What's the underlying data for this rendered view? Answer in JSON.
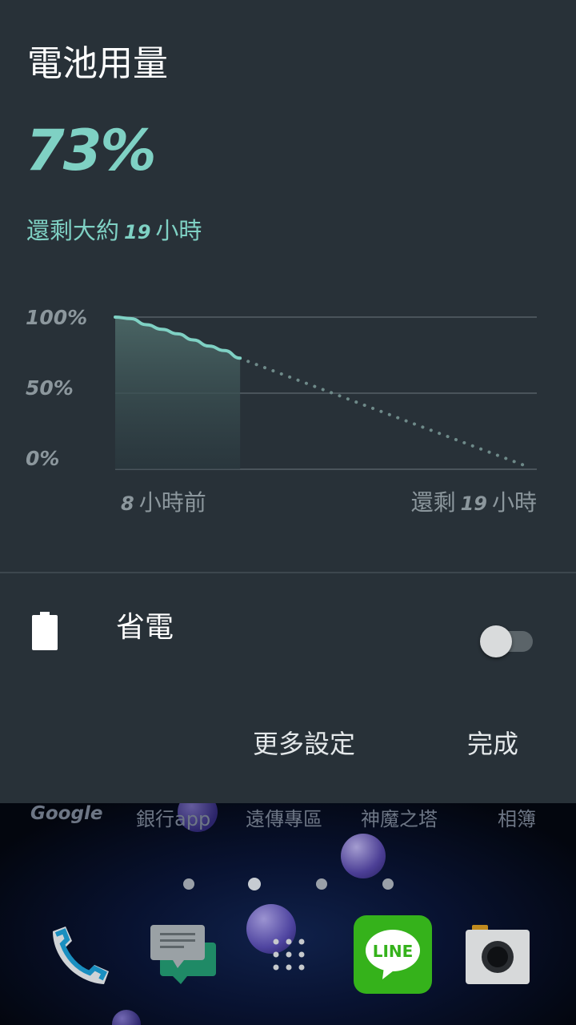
{
  "panel": {
    "title": "電池用量",
    "percent": "73%",
    "remaining_prefix": "還剩大約",
    "remaining_hours": "19",
    "remaining_unit": "小時"
  },
  "chart_data": {
    "type": "area",
    "title": "",
    "xlabel": "",
    "ylabel": "",
    "y_tick_labels": [
      "100%",
      "50%",
      "0%"
    ],
    "ylim": [
      0,
      100
    ],
    "x_start_label": {
      "hours": "8",
      "text": "小時前"
    },
    "x_end_label": {
      "prefix": "還剩",
      "hours": "19",
      "text": "小時"
    },
    "grid": true,
    "series": [
      {
        "kind": "history-solid",
        "x_hours": [
          -8,
          -7,
          -6,
          -5,
          -4,
          -3,
          -2,
          -1,
          0
        ],
        "values": [
          100,
          99,
          95,
          92,
          89,
          85,
          81,
          78,
          73
        ]
      },
      {
        "kind": "prediction-dotted",
        "x_hours": [
          0,
          19
        ],
        "values": [
          73,
          0
        ]
      }
    ],
    "colors": {
      "line": "#7fd1c4",
      "dotted": "#6e8a89",
      "grid": "#4a545b"
    }
  },
  "battery_saver": {
    "label": "省電",
    "enabled": false
  },
  "actions": {
    "more_settings": "更多設定",
    "done": "完成"
  },
  "home": {
    "app_labels": [
      "Google",
      "銀行app",
      "遠傳專區",
      "神魔之塔",
      "相簿"
    ],
    "page_indicator": {
      "pages": 4,
      "active": 2
    },
    "dock": [
      "phone-icon",
      "messages-icon",
      "app-drawer-icon",
      "line-app-icon",
      "camera-icon"
    ]
  }
}
